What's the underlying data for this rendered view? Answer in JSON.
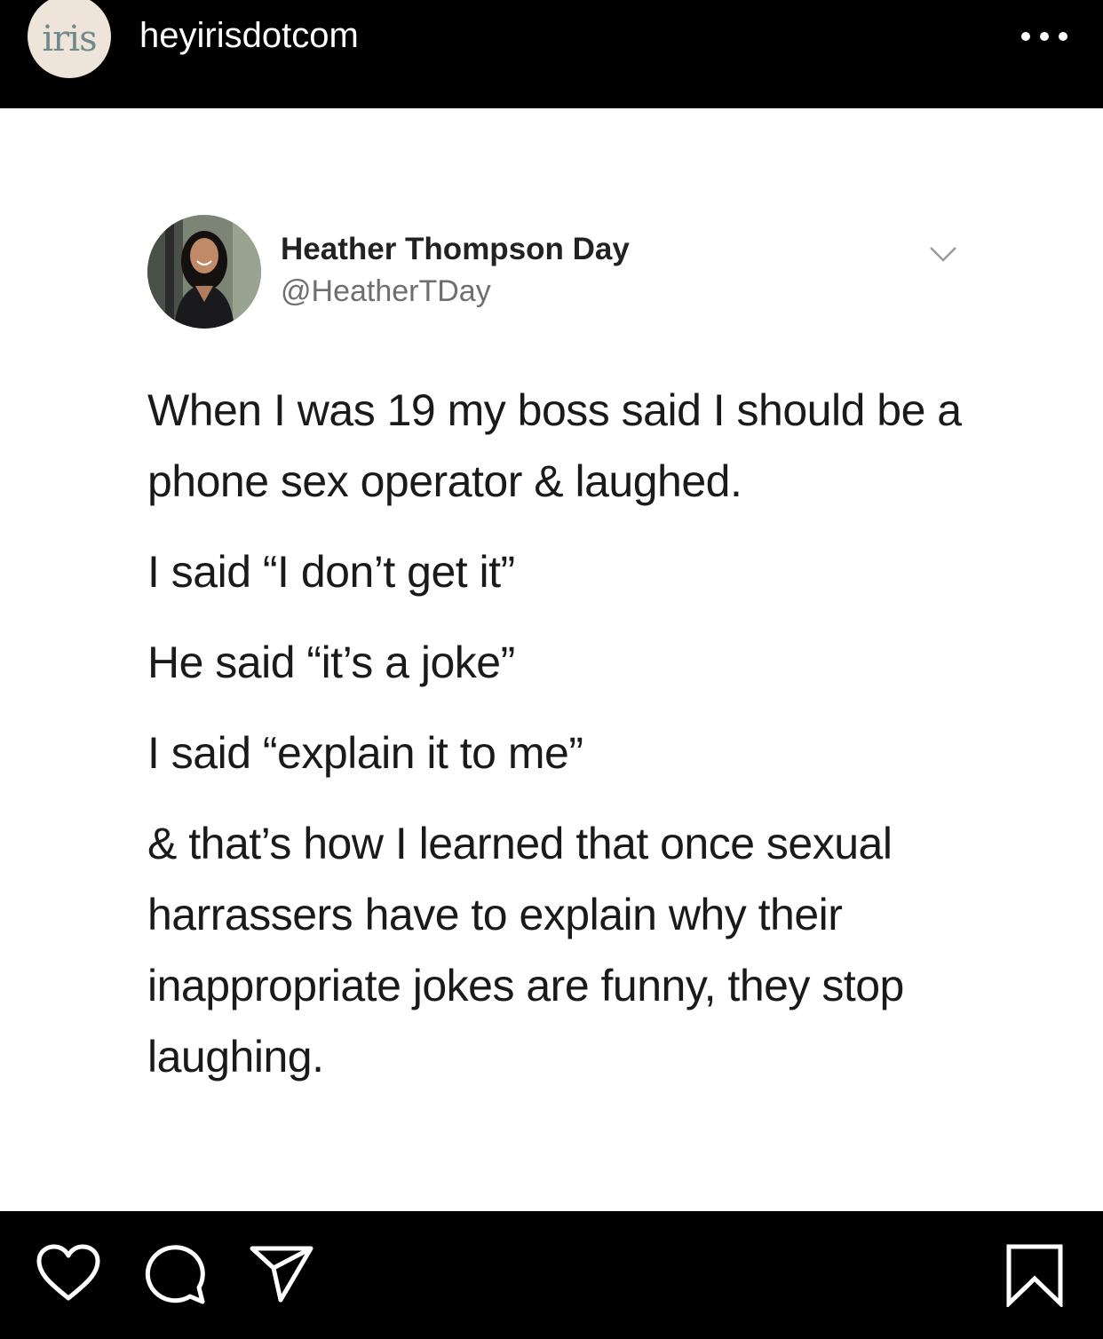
{
  "header": {
    "avatar_text": "iris",
    "username": "heyirisdotcom"
  },
  "tweet": {
    "display_name": "Heather Thompson Day",
    "handle": "@HeatherTDay",
    "paragraphs": [
      "When I was 19 my boss said I should be a phone sex operator & laughed.",
      "I said “I don’t get it”",
      "He said “it’s a joke”",
      "I said “explain it to me”",
      "& that’s how I learned that once sexual harrassers have to explain why their inappropriate jokes are funny, they stop laughing."
    ]
  },
  "icons": {
    "more": "more-options-icon",
    "chevron": "chevron-down-icon",
    "like": "heart-icon",
    "comment": "comment-icon",
    "share": "send-icon",
    "save": "bookmark-icon"
  },
  "colors": {
    "bar_background": "#000000",
    "post_background": "#ffffff",
    "avatar_background": "#efe4da",
    "avatar_text": "#6e8a8a"
  }
}
